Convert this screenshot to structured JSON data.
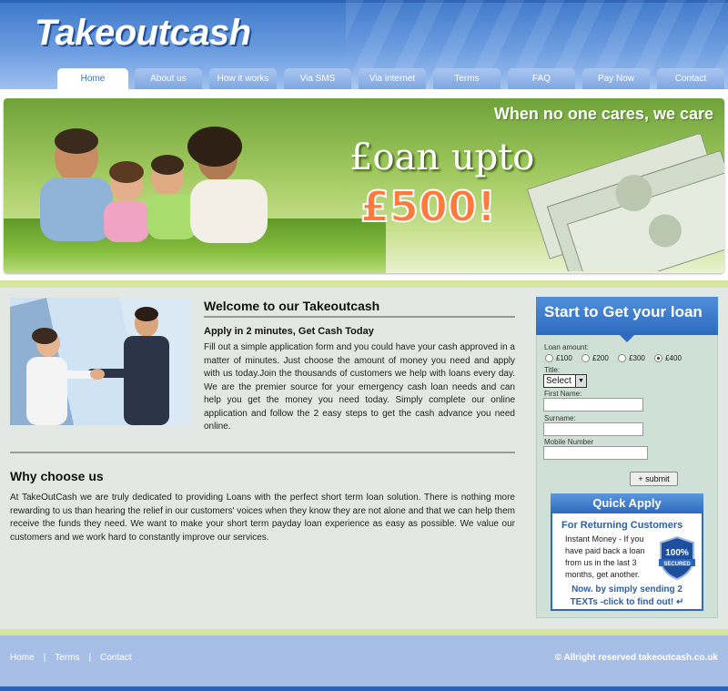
{
  "brand": {
    "logo": "Takeoutcash"
  },
  "nav": [
    {
      "label": "Home",
      "active": true
    },
    {
      "label": "About us"
    },
    {
      "label": "How it works"
    },
    {
      "label": "Via SMS"
    },
    {
      "label": "Via internet"
    },
    {
      "label": "Terms"
    },
    {
      "label": "FAQ"
    },
    {
      "label": "Pay Now"
    },
    {
      "label": "Contact"
    }
  ],
  "banner": {
    "tagline": "When no one cares, we care",
    "line1": "£oan upto",
    "amount": "£500!"
  },
  "welcome": {
    "title": "Welcome to our Takeoutcash",
    "subtitle": "Apply in 2 minutes, Get Cash Today",
    "body": "Fill out a simple application form and you could have your cash approved in a matter of minutes. Just choose the amount of money you need and apply with us today.Join the thousands of customers we help with loans every day. We are the premier source for your emergency cash loan needs and can help you get the money you need today. Simply complete our online application and follow the 2 easy steps to get the cash advance you need online."
  },
  "why": {
    "title": "Why choose us",
    "body": "At TakeOutCash we are truly dedicated to providing Loans with the perfect short term loan solution. There is nothing more rewarding to us than hearing the relief in our customers' voices when they know they are not alone and that we can help them receive the funds they need. We want to make your short term payday loan experience as easy as possible. We value our customers and we work hard to constantly improve our services."
  },
  "form": {
    "heading": "Start to Get your loan",
    "loan_amount_label": "Loan amount:",
    "amounts": [
      {
        "label": "£100",
        "selected": false
      },
      {
        "label": "£200",
        "selected": false
      },
      {
        "label": "£300",
        "selected": false
      },
      {
        "label": "£400",
        "selected": true
      }
    ],
    "title_label": "Title:",
    "title_value": "Select",
    "first_name_label": "First Name:",
    "surname_label": "Surname:",
    "mobile_label": "Mobile Number",
    "submit_label": "+ submit"
  },
  "quick_apply": {
    "heading": "Quick Apply",
    "subheading": "For Returning Customers",
    "text": "Instant Money - If you have paid back a loan from us in the last 3 months, get another.",
    "badge": "100% SECURED",
    "cta": "Now. by simply sending 2 TEXTs -click to find out!"
  },
  "footer": {
    "links": [
      "Home",
      "Terms",
      "Contact"
    ],
    "copyright": "© Allright reserved takeoutcash.co.uk"
  },
  "colors": {
    "brand_blue": "#3d78c9",
    "accent_green": "#d6e59e",
    "amount_orange": "#ff7a3c"
  }
}
